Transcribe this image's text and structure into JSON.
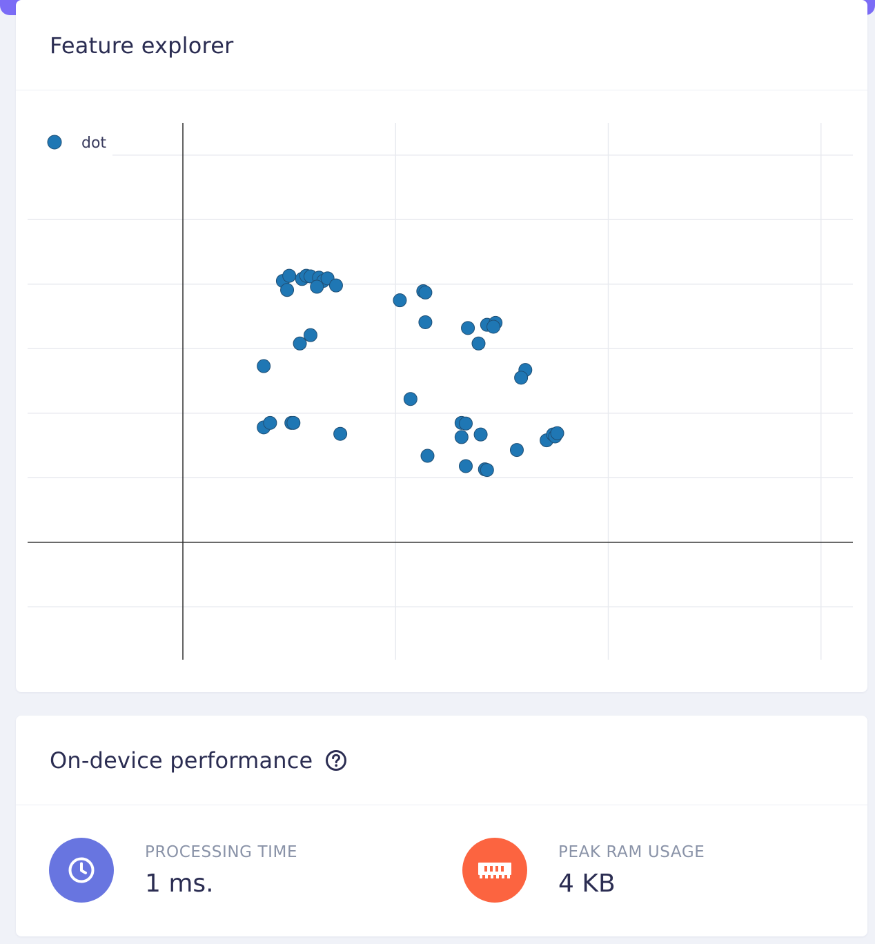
{
  "feature_explorer": {
    "title": "Feature explorer"
  },
  "chart_data": {
    "type": "scatter",
    "series": [
      {
        "name": "dot",
        "color": "#1f77b4",
        "points": [
          [
            0.47,
            4.05
          ],
          [
            0.5,
            4.13
          ],
          [
            0.56,
            4.08
          ],
          [
            0.58,
            4.13
          ],
          [
            0.6,
            4.12
          ],
          [
            0.64,
            4.1
          ],
          [
            0.66,
            4.05
          ],
          [
            0.68,
            4.09
          ],
          [
            0.49,
            3.91
          ],
          [
            0.63,
            3.96
          ],
          [
            0.72,
            3.98
          ],
          [
            1.02,
            3.75
          ],
          [
            1.13,
            3.89
          ],
          [
            1.14,
            3.87
          ],
          [
            1.14,
            3.41
          ],
          [
            1.34,
            3.32
          ],
          [
            1.43,
            3.37
          ],
          [
            1.47,
            3.4
          ],
          [
            1.46,
            3.34
          ],
          [
            1.39,
            3.08
          ],
          [
            1.61,
            2.67
          ],
          [
            1.59,
            2.55
          ],
          [
            0.55,
            3.08
          ],
          [
            0.6,
            3.21
          ],
          [
            0.38,
            2.73
          ],
          [
            0.38,
            1.78
          ],
          [
            0.41,
            1.85
          ],
          [
            0.51,
            1.85
          ],
          [
            0.52,
            1.85
          ],
          [
            0.74,
            1.68
          ],
          [
            1.07,
            2.22
          ],
          [
            1.31,
            1.85
          ],
          [
            1.33,
            1.84
          ],
          [
            1.31,
            1.63
          ],
          [
            1.4,
            1.67
          ],
          [
            1.15,
            1.34
          ],
          [
            1.33,
            1.18
          ],
          [
            1.42,
            1.13
          ],
          [
            1.43,
            1.12
          ],
          [
            1.57,
            1.43
          ],
          [
            1.71,
            1.58
          ],
          [
            1.74,
            1.67
          ],
          [
            1.75,
            1.64
          ],
          [
            1.76,
            1.69
          ]
        ]
      }
    ],
    "xlim": [
      -0.73,
      3.15
    ],
    "ylim": [
      -1.82,
      6.5
    ],
    "grid": true,
    "axis_zero_lines": true,
    "legend_position": "top-left"
  },
  "performance": {
    "title": "On-device performance",
    "help_icon": "question-circle-icon",
    "processing": {
      "label": "PROCESSING TIME",
      "value": "1 ms.",
      "icon": "clock-icon",
      "color": "#6875e0"
    },
    "ram": {
      "label": "PEAK RAM USAGE",
      "value": "4 KB",
      "icon": "memory-chip-icon",
      "color": "#fc6440"
    }
  }
}
